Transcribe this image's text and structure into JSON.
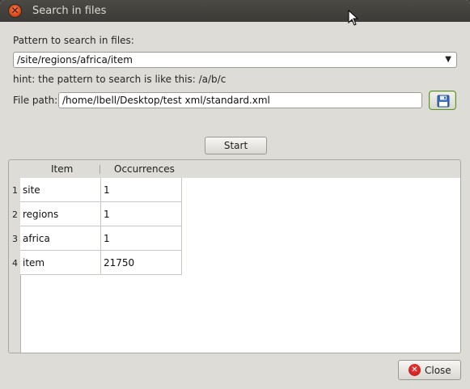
{
  "window": {
    "title": "Search in files"
  },
  "pattern": {
    "label": "Pattern to search in files:",
    "value": "/site/regions/africa/item",
    "hint": "hint: the pattern to search is like this: /a/b/c"
  },
  "file": {
    "label": "File path:",
    "value": "/home/lbell/Desktop/test xml/standard.xml"
  },
  "actions": {
    "start_label": "Start",
    "close_label": "Close"
  },
  "table": {
    "headers": {
      "item": "Item",
      "occurrences": "Occurrences"
    },
    "rows": [
      {
        "num": "1",
        "item": "site",
        "occurrences": "1"
      },
      {
        "num": "2",
        "item": "regions",
        "occurrences": "1"
      },
      {
        "num": "3",
        "item": "africa",
        "occurrences": "1"
      },
      {
        "num": "4",
        "item": "item",
        "occurrences": "21750"
      }
    ]
  },
  "icons": {
    "close": "close-icon",
    "save": "floppy-disk-icon",
    "dropdown": "chevron-down-icon",
    "cursor": "mouse-pointer-icon"
  }
}
